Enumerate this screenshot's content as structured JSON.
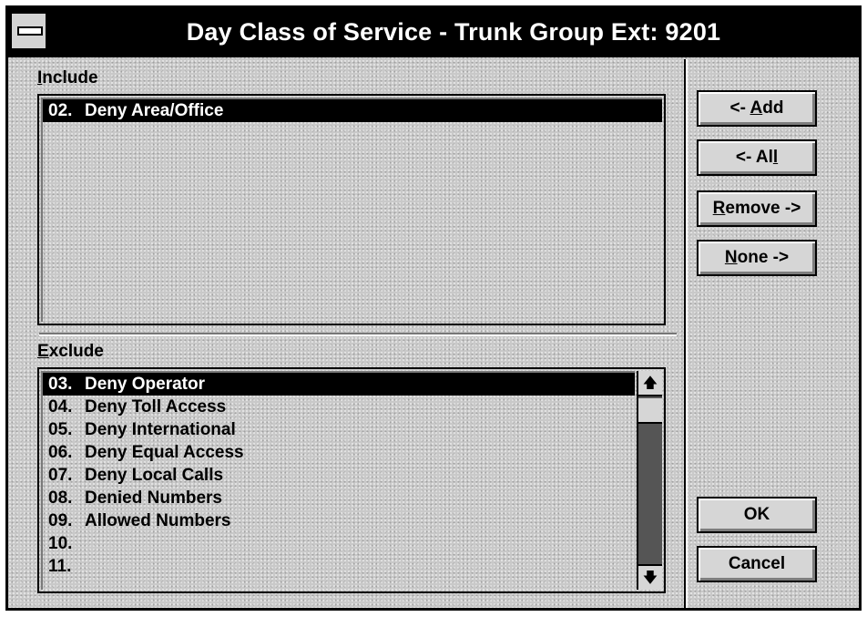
{
  "window": {
    "title": "Day Class of Service - Trunk Group Ext:  9201"
  },
  "include": {
    "label_prefix": "",
    "label_access": "I",
    "label_rest": "nclude",
    "items": [
      {
        "num": "02.",
        "text": "Deny Area/Office",
        "selected": true
      }
    ]
  },
  "exclude": {
    "label_access": "E",
    "label_rest": "xclude",
    "items": [
      {
        "num": "03.",
        "text": "Deny Operator",
        "selected": true
      },
      {
        "num": "04.",
        "text": "Deny Toll Access",
        "selected": false
      },
      {
        "num": "05.",
        "text": "Deny International",
        "selected": false
      },
      {
        "num": "06.",
        "text": "Deny Equal Access",
        "selected": false
      },
      {
        "num": "07.",
        "text": "Deny Local Calls",
        "selected": false
      },
      {
        "num": "08.",
        "text": "Denied Numbers",
        "selected": false
      },
      {
        "num": "09.",
        "text": "Allowed Numbers",
        "selected": false
      },
      {
        "num": "10.",
        "text": "",
        "selected": false
      },
      {
        "num": "11.",
        "text": "",
        "selected": false
      }
    ],
    "scroll_up_icon": "arrow-up",
    "scroll_down_icon": "arrow-down"
  },
  "buttons": {
    "add": {
      "pre": "<- ",
      "access": "A",
      "post": "dd"
    },
    "all": {
      "pre": "<- Al",
      "access": "l",
      "post": ""
    },
    "remove": {
      "pre": "",
      "access": "R",
      "post": "emove ->"
    },
    "none": {
      "pre": "",
      "access": "N",
      "post": "one ->"
    },
    "ok": {
      "label": "OK"
    },
    "cancel": {
      "label": "Cancel"
    }
  }
}
